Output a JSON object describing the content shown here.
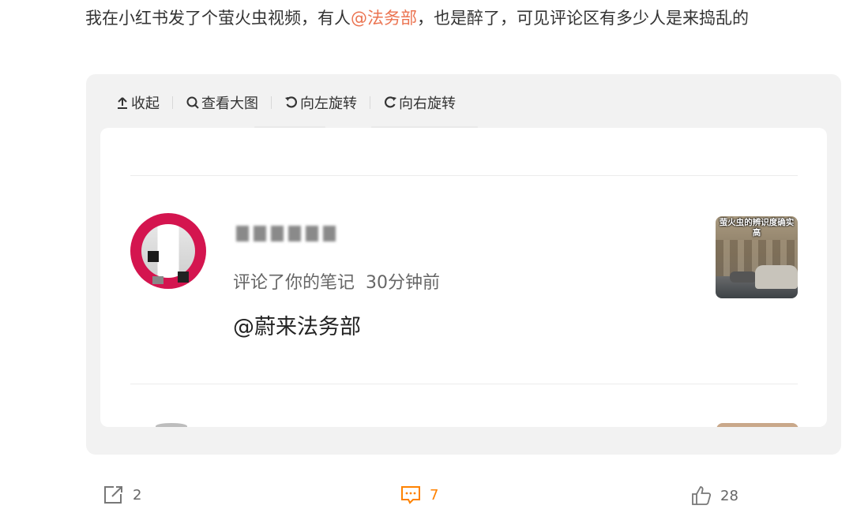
{
  "post": {
    "text_before": "我在小红书发了个萤火虫视频，有人",
    "mention": "@法务部",
    "text_after": "，也是醉了，可见评论区有多少人是来捣乱的"
  },
  "toolbar": {
    "collapse_label": "收起",
    "view_large_label": "查看大图",
    "rotate_left_label": "向左旋转",
    "rotate_right_label": "向右旋转"
  },
  "notification": {
    "action": "评论了你的笔记",
    "time": "30分钟前",
    "comment": "@蔚来法务部",
    "thumbnail_caption": "萤火虫的辨识度确实高"
  },
  "actions": {
    "share_count": "2",
    "comment_count": "7",
    "like_count": "28"
  },
  "colors": {
    "mention": "#eb7350",
    "active_action": "#ff8200",
    "avatar_ring": "#d4154f"
  },
  "icons": {
    "collapse": "collapse-up-icon",
    "zoom": "magnifier-icon",
    "rotate_left": "rotate-left-icon",
    "rotate_right": "rotate-right-icon",
    "share": "share-icon",
    "comment": "comment-icon",
    "like": "thumbs-up-icon"
  }
}
